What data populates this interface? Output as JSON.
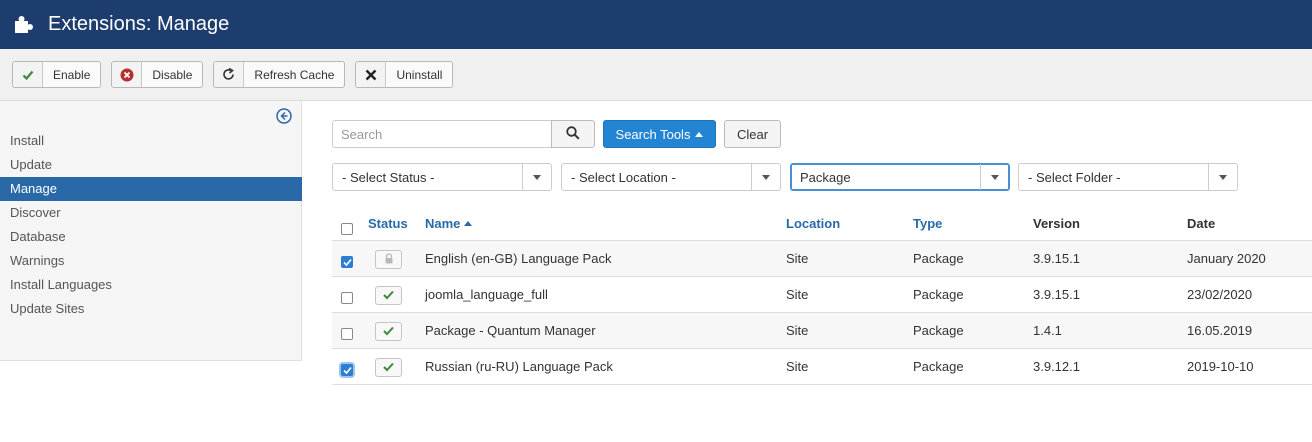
{
  "header": {
    "title": "Extensions: Manage",
    "logo_icon": "joomla-puzzle-icon"
  },
  "toolbar": {
    "buttons": [
      {
        "label": "Enable",
        "icon": "check-icon",
        "color": "#3c8b3c"
      },
      {
        "label": "Disable",
        "icon": "circle-x-icon",
        "color": "#b52f2f"
      },
      {
        "label": "Refresh Cache",
        "icon": "refresh-icon",
        "color": "#333333"
      },
      {
        "label": "Uninstall",
        "icon": "x-icon",
        "color": "#222222"
      }
    ]
  },
  "sidebar": {
    "items": [
      {
        "label": "Install",
        "active": false
      },
      {
        "label": "Update",
        "active": false
      },
      {
        "label": "Manage",
        "active": true
      },
      {
        "label": "Discover",
        "active": false
      },
      {
        "label": "Database",
        "active": false
      },
      {
        "label": "Warnings",
        "active": false
      },
      {
        "label": "Install Languages",
        "active": false
      },
      {
        "label": "Update Sites",
        "active": false
      }
    ]
  },
  "search": {
    "placeholder": "Search",
    "tools_label": "Search Tools",
    "clear_label": "Clear"
  },
  "filters": {
    "status": "- Select Status -",
    "location": "- Select Location -",
    "type": "Package",
    "folder": "- Select Folder -"
  },
  "table": {
    "headers": {
      "status": "Status",
      "name": "Name",
      "location": "Location",
      "type": "Type",
      "version": "Version",
      "date": "Date"
    },
    "rows": [
      {
        "checked": true,
        "status": "locked",
        "name": "English (en-GB) Language Pack",
        "location": "Site",
        "type": "Package",
        "version": "3.9.15.1",
        "date": "January 2020"
      },
      {
        "checked": false,
        "status": "enabled",
        "name": "joomla_language_full",
        "location": "Site",
        "type": "Package",
        "version": "3.9.15.1",
        "date": "23/02/2020"
      },
      {
        "checked": false,
        "status": "enabled",
        "name": "Package - Quantum Manager",
        "location": "Site",
        "type": "Package",
        "version": "1.4.1",
        "date": "16.05.2019"
      },
      {
        "checked": true,
        "status": "enabled",
        "name": "Russian (ru-RU) Language Pack",
        "location": "Site",
        "type": "Package",
        "version": "3.9.12.1",
        "date": "2019-10-10"
      }
    ]
  },
  "colors": {
    "header_bg": "#1c3d6e",
    "accent": "#2a69a8",
    "primary_button": "#2384d3",
    "enabled_check": "#3c8b3c"
  }
}
